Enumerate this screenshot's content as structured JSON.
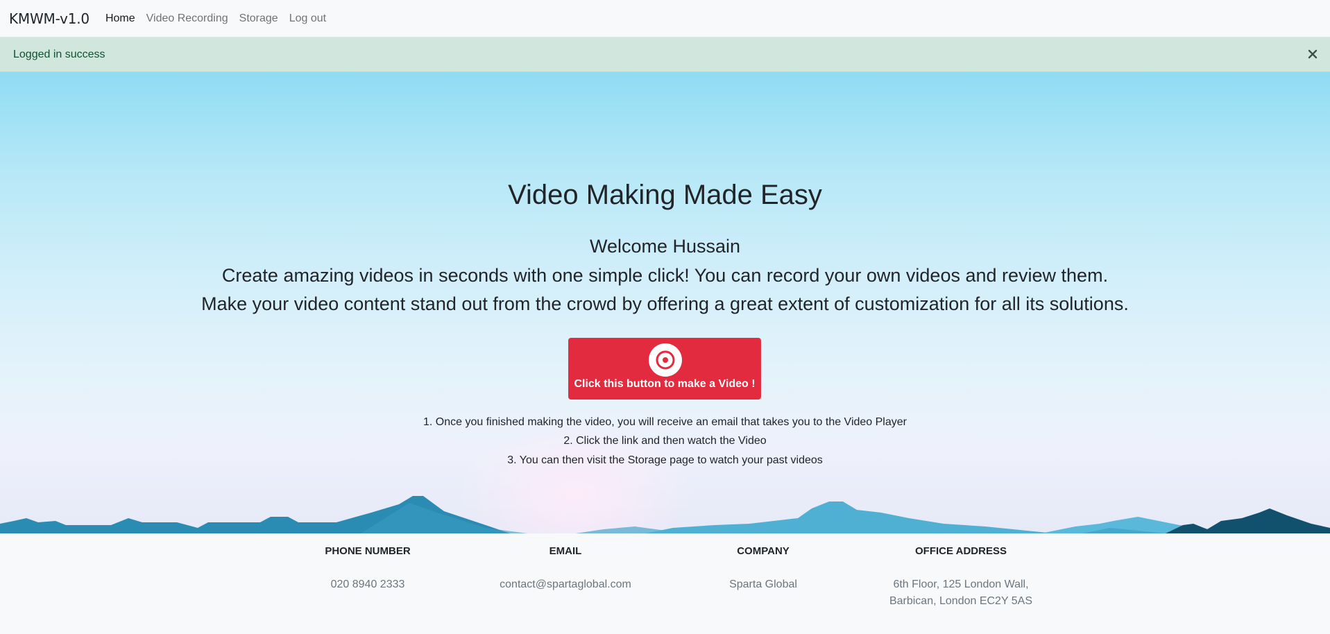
{
  "nav": {
    "brand": "KMWM-v1.0",
    "items": [
      {
        "label": "Home",
        "active": true
      },
      {
        "label": "Video Recording",
        "active": false
      },
      {
        "label": "Storage",
        "active": false
      },
      {
        "label": "Log out",
        "active": false
      }
    ]
  },
  "alert": {
    "message": "Logged in success",
    "close_icon": "close-x-icon",
    "color": "#d1e7dd"
  },
  "hero": {
    "title": "Video Making Made Easy",
    "welcome": "Welcome Hussain",
    "tagline_1": "Create amazing videos in seconds with one simple click! You can record your own videos and review them.",
    "tagline_2": "Make your video content stand out from the crowd by offering a great extent of customization for all its solutions.",
    "record_button": {
      "label": "Click this button to make a Video !",
      "icon": "record-circle-icon",
      "color": "#e32b3f"
    },
    "steps": [
      "1. Once you finished making the video, you will receive an email that takes you to the Video Player",
      "2. Click the link and then watch the Video",
      "3. You can then visit the Storage page to watch your past videos"
    ]
  },
  "footer": {
    "columns": [
      {
        "heading": "PHONE NUMBER",
        "value": "020 8940 2333"
      },
      {
        "heading": "EMAIL",
        "value": "contact@spartaglobal.com"
      },
      {
        "heading": "COMPANY",
        "value": "Sparta Global"
      },
      {
        "heading": "OFFICE ADDRESS",
        "value_line_1": "6th Floor, 125 London Wall,",
        "value_line_2": "Barbican, London EC2Y 5AS"
      }
    ]
  }
}
